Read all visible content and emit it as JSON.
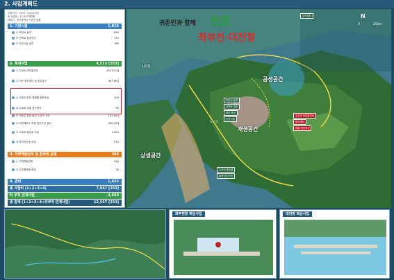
{
  "header": {
    "title": "2. 사업계획도"
  },
  "panel": {
    "meta": [
      "사업기간 : 2021~2023(3년)",
      "총 사업비 : 12,597백만원",
      "대상지 : 부산광역시 기장군 일원"
    ],
    "sections": [
      {
        "title": "1. 기반시설",
        "value": "1,819",
        "color": "#3a7fc1",
        "items": [
          {
            "label": "① 보안교 설치",
            "value": "690"
          },
          {
            "label": "② 산책로 환경개선",
            "value": "751"
          },
          {
            "label": "③ 안전시설 설치",
            "value": "189"
          }
        ]
      },
      {
        "title": "2. 특화사업",
        "value": "4,513 [253]",
        "color": "#3a9d4a",
        "items": [
          {
            "label": "① 주쿠비 바다놀이터",
            "value": "452 [113]"
          },
          {
            "label": "② 어린 한보센터 및 공유공간",
            "value": "587 [60]"
          },
          {
            "label": "③ 귀존인 한년 재해원 정원조성",
            "value": "100"
          },
          {
            "label": "④ 주쿠비 마을 경관개선",
            "value": "90"
          },
          {
            "label": "⑤ 귀존인 한년 광장 주쿠비 식당",
            "value": "181 [40]"
          },
          {
            "label": "⑥ 여민해모두 마켓 업단사인 설치",
            "value": "356 [40]"
          },
          {
            "label": "⑦ 주쿠비 중앙광 조성",
            "value": "1,630"
          },
          {
            "label": "⑧ 마지막관광 조성",
            "value": "510"
          }
        ]
      },
      {
        "title": "3. 지역역량강화 및 협의체 운영",
        "value": "393",
        "color": "#e67e22",
        "items": [
          {
            "label": "① 지역역량강화",
            "value": "318"
          },
          {
            "label": "② 주민협의체 운영",
            "value": "75"
          }
        ]
      }
    ],
    "totals": [
      {
        "label": "4. 경비",
        "value": "1,422",
        "color": "#3a7fc1"
      },
      {
        "label": "총 사업비 (1+2+3+4)",
        "value": "7,947 [253]",
        "color": "#2e6e9e"
      },
      {
        "label": "타 부처 연계사업",
        "value": "4,650",
        "color": "#3a9d4a"
      },
      {
        "label": "총 합계 (1+2+3+4+타부처 연계사업)",
        "value": "12,597 [253]",
        "color": "#26597a"
      }
    ]
  },
  "map": {
    "slogan": "귀존인과 함께",
    "brand": "生生",
    "name_left": "좌부천",
    "name_dot": "·",
    "name_right": "대천항",
    "zones": {
      "shared": "공생공간",
      "regen": "재생공간",
      "coexist": "상생공간"
    },
    "places": [
      "사화항",
      "노인산",
      "N"
    ],
    "tags": [
      "주민센터",
      "보안교 설치",
      "산책로 정비",
      "쉼터 조성",
      "안전시설",
      "주쿠비 바다놀이터",
      "한보센터",
      "마을 경관개선",
      "주쿠비 중앙광",
      "마켓 업단사인"
    ],
    "scale": [
      "0",
      "250m"
    ]
  },
  "bottom": [
    {
      "title": ""
    },
    {
      "title": "좌부천항 핵심사업"
    },
    {
      "title": "대천항 핵심사업"
    }
  ],
  "colors": {
    "brand_green": "#2a9d3a",
    "brand_red": "#d32f2f",
    "panel_blue": "#3a7fc1"
  }
}
